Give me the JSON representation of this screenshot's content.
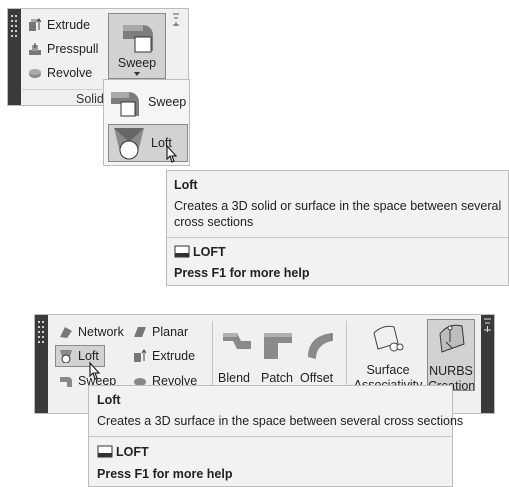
{
  "top": {
    "items": [
      {
        "label": "Extrude",
        "icon": "extrude-icon"
      },
      {
        "label": "Presspull",
        "icon": "presspull-icon"
      },
      {
        "label": "Revolve",
        "icon": "revolve-icon"
      }
    ],
    "sweep_button_label": "Sweep",
    "panel_title": "Solid",
    "flyout": [
      {
        "label": "Sweep",
        "icon": "sweep-icon"
      },
      {
        "label": "Loft",
        "icon": "loft-icon"
      }
    ],
    "tooltip": {
      "title": "Loft",
      "description": "Creates a 3D solid or surface in the space between several cross sections",
      "command": "LOFT",
      "help": "Press F1 for more help"
    }
  },
  "bottom": {
    "col1": [
      {
        "label": "Network",
        "icon": "network-icon"
      },
      {
        "label": "Loft",
        "icon": "loft-icon"
      },
      {
        "label": "Sweep",
        "icon": "sweep-icon"
      }
    ],
    "col2": [
      {
        "label": "Planar",
        "icon": "planar-icon"
      },
      {
        "label": "Extrude",
        "icon": "extrude-icon"
      },
      {
        "label": "Revolve",
        "icon": "revolve-icon"
      }
    ],
    "large_buttons": [
      {
        "label": "Blend",
        "icon": "blend-icon"
      },
      {
        "label": "Patch",
        "icon": "patch-icon"
      },
      {
        "label": "Offset",
        "icon": "offset-icon"
      }
    ],
    "surface_associativity": {
      "line1": "Surface",
      "line2": "Associativity"
    },
    "nurbs_creation": {
      "line1": "NURBS",
      "line2": "Creation"
    },
    "tooltip": {
      "title": "Loft",
      "description": "Creates a 3D surface in the space between several cross sections",
      "command": "LOFT",
      "help": "Press F1 for more help"
    }
  }
}
